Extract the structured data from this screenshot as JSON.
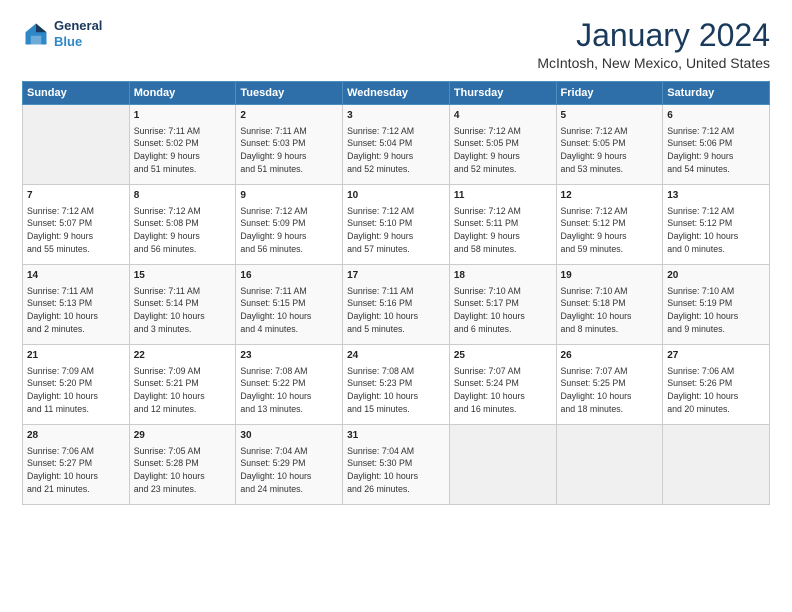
{
  "header": {
    "logo_line1": "General",
    "logo_line2": "Blue",
    "main_title": "January 2024",
    "subtitle": "McIntosh, New Mexico, United States"
  },
  "calendar": {
    "days_of_week": [
      "Sunday",
      "Monday",
      "Tuesday",
      "Wednesday",
      "Thursday",
      "Friday",
      "Saturday"
    ],
    "weeks": [
      [
        {
          "day": "",
          "info": ""
        },
        {
          "day": "1",
          "info": "Sunrise: 7:11 AM\nSunset: 5:02 PM\nDaylight: 9 hours\nand 51 minutes."
        },
        {
          "day": "2",
          "info": "Sunrise: 7:11 AM\nSunset: 5:03 PM\nDaylight: 9 hours\nand 51 minutes."
        },
        {
          "day": "3",
          "info": "Sunrise: 7:12 AM\nSunset: 5:04 PM\nDaylight: 9 hours\nand 52 minutes."
        },
        {
          "day": "4",
          "info": "Sunrise: 7:12 AM\nSunset: 5:05 PM\nDaylight: 9 hours\nand 52 minutes."
        },
        {
          "day": "5",
          "info": "Sunrise: 7:12 AM\nSunset: 5:05 PM\nDaylight: 9 hours\nand 53 minutes."
        },
        {
          "day": "6",
          "info": "Sunrise: 7:12 AM\nSunset: 5:06 PM\nDaylight: 9 hours\nand 54 minutes."
        }
      ],
      [
        {
          "day": "7",
          "info": "Sunrise: 7:12 AM\nSunset: 5:07 PM\nDaylight: 9 hours\nand 55 minutes."
        },
        {
          "day": "8",
          "info": "Sunrise: 7:12 AM\nSunset: 5:08 PM\nDaylight: 9 hours\nand 56 minutes."
        },
        {
          "day": "9",
          "info": "Sunrise: 7:12 AM\nSunset: 5:09 PM\nDaylight: 9 hours\nand 56 minutes."
        },
        {
          "day": "10",
          "info": "Sunrise: 7:12 AM\nSunset: 5:10 PM\nDaylight: 9 hours\nand 57 minutes."
        },
        {
          "day": "11",
          "info": "Sunrise: 7:12 AM\nSunset: 5:11 PM\nDaylight: 9 hours\nand 58 minutes."
        },
        {
          "day": "12",
          "info": "Sunrise: 7:12 AM\nSunset: 5:12 PM\nDaylight: 9 hours\nand 59 minutes."
        },
        {
          "day": "13",
          "info": "Sunrise: 7:12 AM\nSunset: 5:12 PM\nDaylight: 10 hours\nand 0 minutes."
        }
      ],
      [
        {
          "day": "14",
          "info": "Sunrise: 7:11 AM\nSunset: 5:13 PM\nDaylight: 10 hours\nand 2 minutes."
        },
        {
          "day": "15",
          "info": "Sunrise: 7:11 AM\nSunset: 5:14 PM\nDaylight: 10 hours\nand 3 minutes."
        },
        {
          "day": "16",
          "info": "Sunrise: 7:11 AM\nSunset: 5:15 PM\nDaylight: 10 hours\nand 4 minutes."
        },
        {
          "day": "17",
          "info": "Sunrise: 7:11 AM\nSunset: 5:16 PM\nDaylight: 10 hours\nand 5 minutes."
        },
        {
          "day": "18",
          "info": "Sunrise: 7:10 AM\nSunset: 5:17 PM\nDaylight: 10 hours\nand 6 minutes."
        },
        {
          "day": "19",
          "info": "Sunrise: 7:10 AM\nSunset: 5:18 PM\nDaylight: 10 hours\nand 8 minutes."
        },
        {
          "day": "20",
          "info": "Sunrise: 7:10 AM\nSunset: 5:19 PM\nDaylight: 10 hours\nand 9 minutes."
        }
      ],
      [
        {
          "day": "21",
          "info": "Sunrise: 7:09 AM\nSunset: 5:20 PM\nDaylight: 10 hours\nand 11 minutes."
        },
        {
          "day": "22",
          "info": "Sunrise: 7:09 AM\nSunset: 5:21 PM\nDaylight: 10 hours\nand 12 minutes."
        },
        {
          "day": "23",
          "info": "Sunrise: 7:08 AM\nSunset: 5:22 PM\nDaylight: 10 hours\nand 13 minutes."
        },
        {
          "day": "24",
          "info": "Sunrise: 7:08 AM\nSunset: 5:23 PM\nDaylight: 10 hours\nand 15 minutes."
        },
        {
          "day": "25",
          "info": "Sunrise: 7:07 AM\nSunset: 5:24 PM\nDaylight: 10 hours\nand 16 minutes."
        },
        {
          "day": "26",
          "info": "Sunrise: 7:07 AM\nSunset: 5:25 PM\nDaylight: 10 hours\nand 18 minutes."
        },
        {
          "day": "27",
          "info": "Sunrise: 7:06 AM\nSunset: 5:26 PM\nDaylight: 10 hours\nand 20 minutes."
        }
      ],
      [
        {
          "day": "28",
          "info": "Sunrise: 7:06 AM\nSunset: 5:27 PM\nDaylight: 10 hours\nand 21 minutes."
        },
        {
          "day": "29",
          "info": "Sunrise: 7:05 AM\nSunset: 5:28 PM\nDaylight: 10 hours\nand 23 minutes."
        },
        {
          "day": "30",
          "info": "Sunrise: 7:04 AM\nSunset: 5:29 PM\nDaylight: 10 hours\nand 24 minutes."
        },
        {
          "day": "31",
          "info": "Sunrise: 7:04 AM\nSunset: 5:30 PM\nDaylight: 10 hours\nand 26 minutes."
        },
        {
          "day": "",
          "info": ""
        },
        {
          "day": "",
          "info": ""
        },
        {
          "day": "",
          "info": ""
        }
      ]
    ]
  }
}
